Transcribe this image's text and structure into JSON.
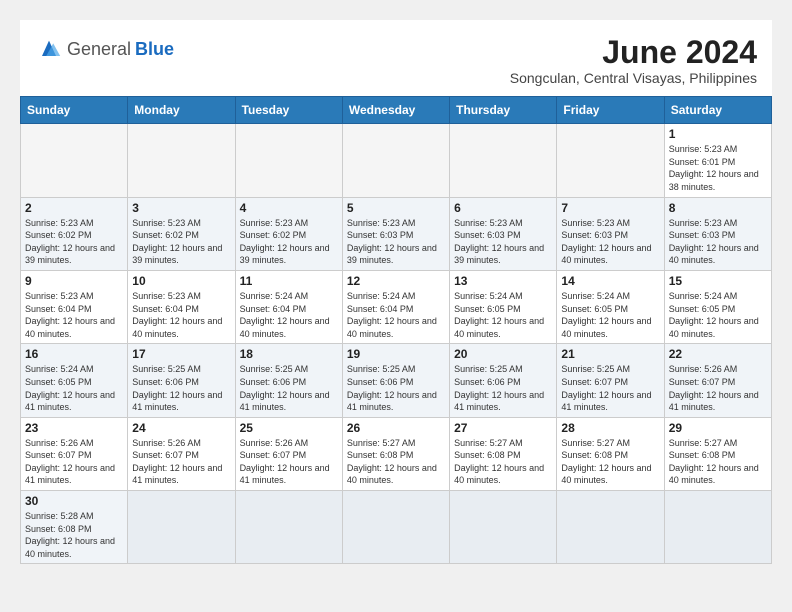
{
  "header": {
    "logo_general": "General",
    "logo_blue": "Blue",
    "month_year": "June 2024",
    "location": "Songculan, Central Visayas, Philippines"
  },
  "weekdays": [
    "Sunday",
    "Monday",
    "Tuesday",
    "Wednesday",
    "Thursday",
    "Friday",
    "Saturday"
  ],
  "days": {
    "1": {
      "sunrise": "5:23 AM",
      "sunset": "6:01 PM",
      "daylight": "12 hours and 38 minutes."
    },
    "2": {
      "sunrise": "5:23 AM",
      "sunset": "6:02 PM",
      "daylight": "12 hours and 39 minutes."
    },
    "3": {
      "sunrise": "5:23 AM",
      "sunset": "6:02 PM",
      "daylight": "12 hours and 39 minutes."
    },
    "4": {
      "sunrise": "5:23 AM",
      "sunset": "6:02 PM",
      "daylight": "12 hours and 39 minutes."
    },
    "5": {
      "sunrise": "5:23 AM",
      "sunset": "6:03 PM",
      "daylight": "12 hours and 39 minutes."
    },
    "6": {
      "sunrise": "5:23 AM",
      "sunset": "6:03 PM",
      "daylight": "12 hours and 39 minutes."
    },
    "7": {
      "sunrise": "5:23 AM",
      "sunset": "6:03 PM",
      "daylight": "12 hours and 40 minutes."
    },
    "8": {
      "sunrise": "5:23 AM",
      "sunset": "6:03 PM",
      "daylight": "12 hours and 40 minutes."
    },
    "9": {
      "sunrise": "5:23 AM",
      "sunset": "6:04 PM",
      "daylight": "12 hours and 40 minutes."
    },
    "10": {
      "sunrise": "5:23 AM",
      "sunset": "6:04 PM",
      "daylight": "12 hours and 40 minutes."
    },
    "11": {
      "sunrise": "5:24 AM",
      "sunset": "6:04 PM",
      "daylight": "12 hours and 40 minutes."
    },
    "12": {
      "sunrise": "5:24 AM",
      "sunset": "6:04 PM",
      "daylight": "12 hours and 40 minutes."
    },
    "13": {
      "sunrise": "5:24 AM",
      "sunset": "6:05 PM",
      "daylight": "12 hours and 40 minutes."
    },
    "14": {
      "sunrise": "5:24 AM",
      "sunset": "6:05 PM",
      "daylight": "12 hours and 40 minutes."
    },
    "15": {
      "sunrise": "5:24 AM",
      "sunset": "6:05 PM",
      "daylight": "12 hours and 40 minutes."
    },
    "16": {
      "sunrise": "5:24 AM",
      "sunset": "6:05 PM",
      "daylight": "12 hours and 41 minutes."
    },
    "17": {
      "sunrise": "5:25 AM",
      "sunset": "6:06 PM",
      "daylight": "12 hours and 41 minutes."
    },
    "18": {
      "sunrise": "5:25 AM",
      "sunset": "6:06 PM",
      "daylight": "12 hours and 41 minutes."
    },
    "19": {
      "sunrise": "5:25 AM",
      "sunset": "6:06 PM",
      "daylight": "12 hours and 41 minutes."
    },
    "20": {
      "sunrise": "5:25 AM",
      "sunset": "6:06 PM",
      "daylight": "12 hours and 41 minutes."
    },
    "21": {
      "sunrise": "5:25 AM",
      "sunset": "6:07 PM",
      "daylight": "12 hours and 41 minutes."
    },
    "22": {
      "sunrise": "5:26 AM",
      "sunset": "6:07 PM",
      "daylight": "12 hours and 41 minutes."
    },
    "23": {
      "sunrise": "5:26 AM",
      "sunset": "6:07 PM",
      "daylight": "12 hours and 41 minutes."
    },
    "24": {
      "sunrise": "5:26 AM",
      "sunset": "6:07 PM",
      "daylight": "12 hours and 41 minutes."
    },
    "25": {
      "sunrise": "5:26 AM",
      "sunset": "6:07 PM",
      "daylight": "12 hours and 41 minutes."
    },
    "26": {
      "sunrise": "5:27 AM",
      "sunset": "6:08 PM",
      "daylight": "12 hours and 40 minutes."
    },
    "27": {
      "sunrise": "5:27 AM",
      "sunset": "6:08 PM",
      "daylight": "12 hours and 40 minutes."
    },
    "28": {
      "sunrise": "5:27 AM",
      "sunset": "6:08 PM",
      "daylight": "12 hours and 40 minutes."
    },
    "29": {
      "sunrise": "5:27 AM",
      "sunset": "6:08 PM",
      "daylight": "12 hours and 40 minutes."
    },
    "30": {
      "sunrise": "5:28 AM",
      "sunset": "6:08 PM",
      "daylight": "12 hours and 40 minutes."
    }
  },
  "labels": {
    "sunrise": "Sunrise:",
    "sunset": "Sunset:",
    "daylight": "Daylight:"
  }
}
